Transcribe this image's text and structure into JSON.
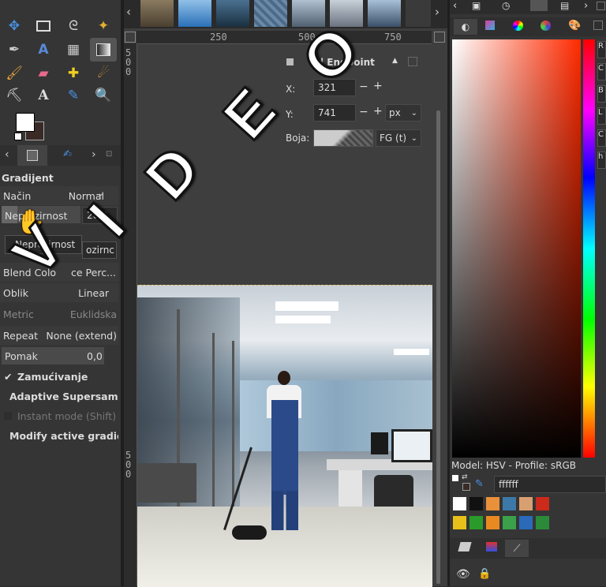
{
  "tabs_top": {
    "icons": [
      "image-icon",
      "history-icon",
      "layers-icon",
      "channels-icon",
      "menu-icon"
    ]
  },
  "toolbox": {
    "tools": [
      "move-tool-icon",
      "rect-select-icon",
      "lasso-icon",
      "fuzzy-select-icon",
      "paths-icon",
      "text-warp-icon",
      "transform-icon",
      "gradient-icon",
      "paintbrush-icon",
      "eraser-icon",
      "heal-icon",
      "smudge-icon",
      "clone-icon",
      "text-tool-icon",
      "color-picker-icon",
      "zoom-icon"
    ]
  },
  "tool_options": {
    "title": "Gradijent",
    "mode_label": "Način",
    "mode_value": "Normal",
    "opacity_label": "Neprozirnost",
    "opacity_value": "20,0",
    "opacity_tooltip": "Neprozirnost",
    "opacity_tooltip_right": "ozirnc",
    "blend_label": "Blend Colo",
    "blend_value": "ce Perc...",
    "shape_label": "Oblik",
    "shape_value": "Linear",
    "metric_label": "Metric",
    "metric_value": "Euklidska",
    "repeat_label": "Repeat",
    "repeat_value": "None (extend)",
    "offset_label": "Pomak",
    "offset_value": "0,0",
    "dither_label": "Zamućivanje",
    "supersample_label": "Adaptive Supersampl",
    "instant_label": "Instant mode  (Shift)",
    "modify_label": "Modify active gradier"
  },
  "endpoint_panel": {
    "title": "nd Endpoint",
    "x_label": "X:",
    "x_value": "321",
    "y_label": "Y:",
    "y_value": "741",
    "unit": "px",
    "color_label": "Boja:",
    "color_value": "FG (t)"
  },
  "ruler": {
    "top": [
      "250",
      "500",
      "750"
    ],
    "left": [
      "5",
      "0",
      "0",
      "5",
      "0",
      "0"
    ]
  },
  "overlay_text": [
    "V",
    "I",
    "D",
    "E",
    "O"
  ],
  "color_panel": {
    "model_label": "Model: HSV - Profile: sRGB",
    "hex_value": "ffffff",
    "channel_labels": [
      "R",
      "C",
      "B",
      "L",
      "C",
      "h"
    ],
    "swatches": [
      "#ffffff",
      "#111111",
      "#e8903a",
      "#3c78a8",
      "#d8a070",
      "#cc2a1a",
      "#e8c01a",
      "#2a9a2a",
      "#e88a20",
      "#3aa04a",
      "#2a6ab8",
      "#2a8a3a"
    ]
  },
  "colors": {
    "accent_red": "#ff2a00",
    "fg": "#ffffff",
    "bg": "#3a2a26"
  }
}
